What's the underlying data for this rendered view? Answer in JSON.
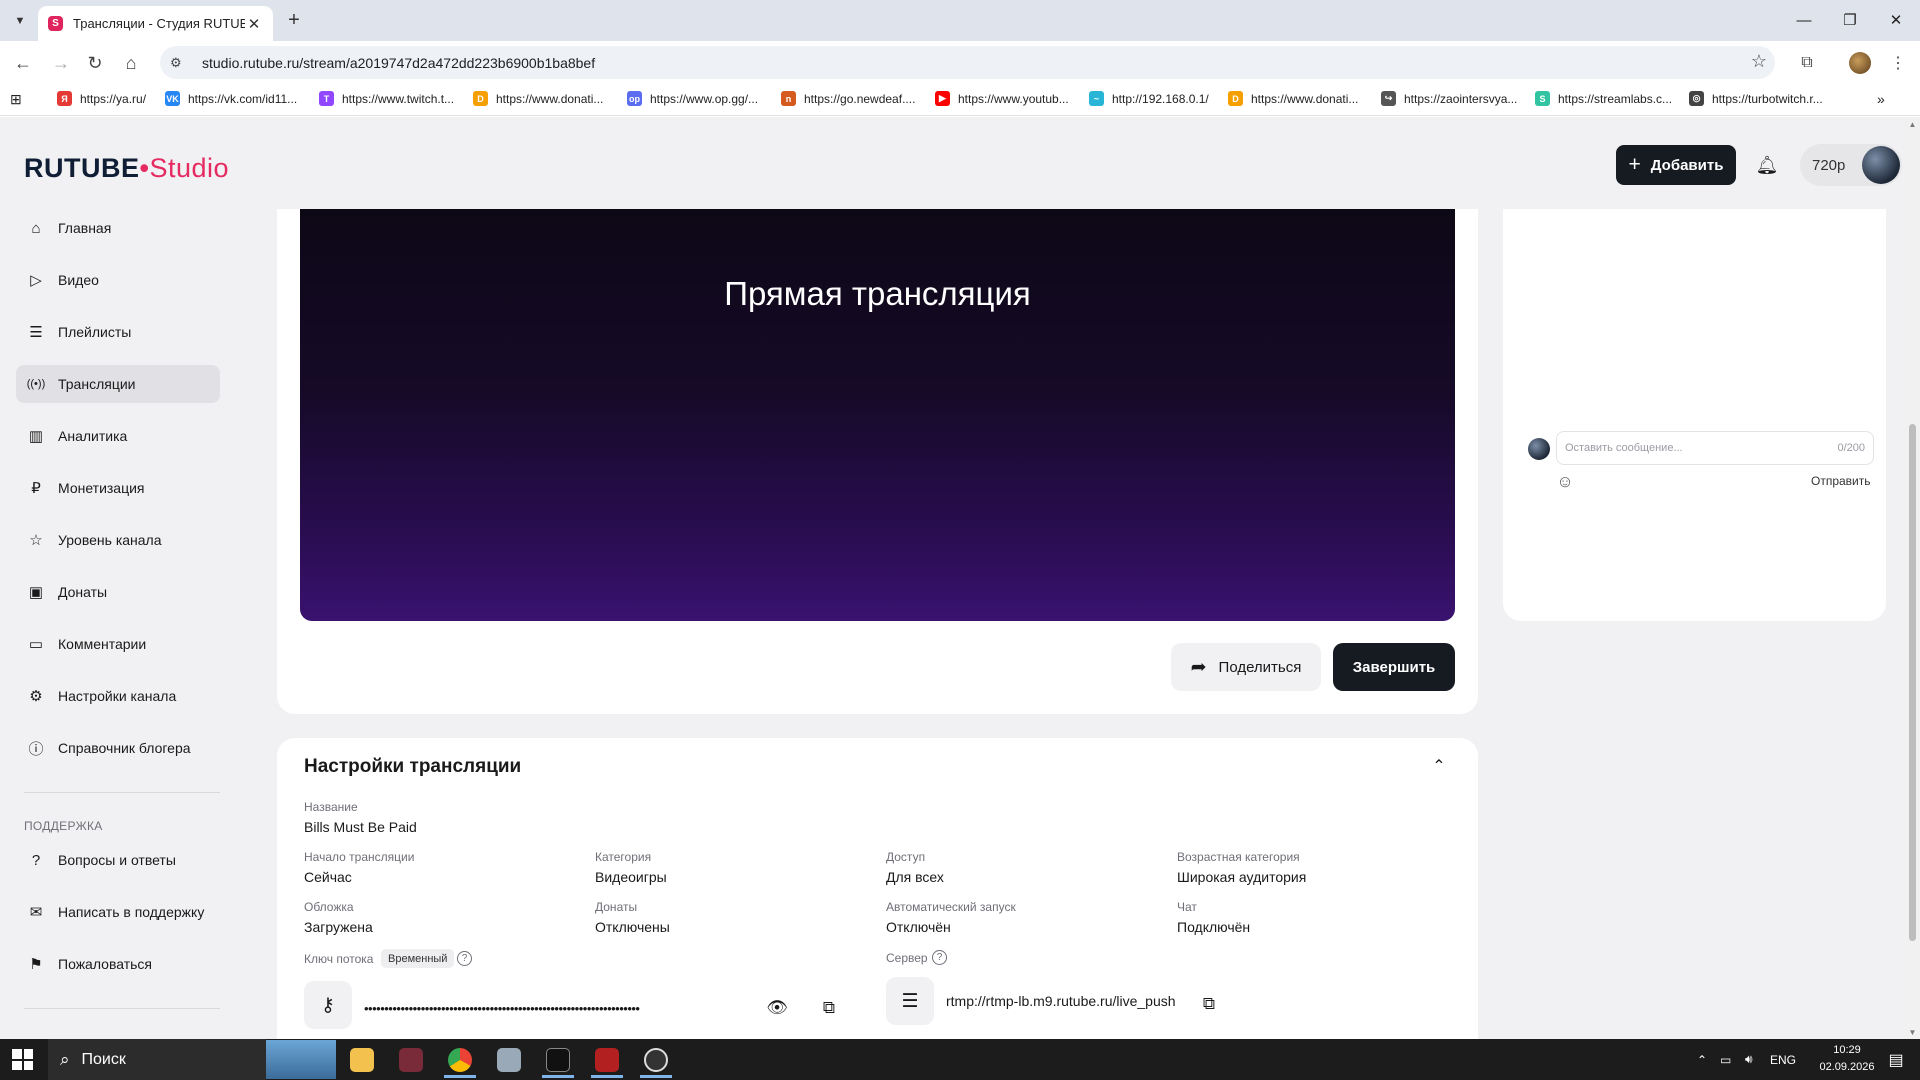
{
  "browser": {
    "tab_title": "Трансляции - Студия RUTUBE",
    "url": "studio.rutube.ru/stream/a2019747d2a472dd223b6900b1ba8bef",
    "bookmarks": [
      {
        "label": "https://ya.ru/",
        "color": "#e53935",
        "glyph": "Я"
      },
      {
        "label": "https://vk.com/id11...",
        "color": "#2787f5",
        "glyph": "VK"
      },
      {
        "label": "https://www.twitch.t...",
        "color": "#9146ff",
        "glyph": "T"
      },
      {
        "label": "https://www.donati...",
        "color": "#f59f00",
        "glyph": "D"
      },
      {
        "label": "https://www.op.gg/...",
        "color": "#5a6cf0",
        "glyph": "op"
      },
      {
        "label": "https://go.newdeaf....",
        "color": "#d45a1d",
        "glyph": "n"
      },
      {
        "label": "https://www.youtub...",
        "color": "#ff0000",
        "glyph": "▶"
      },
      {
        "label": "http://192.168.0.1/",
        "color": "#29b6d6",
        "glyph": "~"
      },
      {
        "label": "https://www.donati...",
        "color": "#f59f00",
        "glyph": "D"
      },
      {
        "label": "https://zaointersvya...",
        "color": "#555555",
        "glyph": "↪"
      },
      {
        "label": "https://streamlabs.c...",
        "color": "#31c3a2",
        "glyph": "S"
      },
      {
        "label": "https://turbotwitch.r...",
        "color": "#444444",
        "glyph": "◎"
      }
    ]
  },
  "header": {
    "logo_main": "RUTUBE",
    "logo_dot": "•",
    "logo_studio": "Studio",
    "add_button": "Добавить",
    "quality": "720p"
  },
  "sidebar": {
    "items": [
      {
        "label": "Главная",
        "icon": "⌂"
      },
      {
        "label": "Видео",
        "icon": "▷"
      },
      {
        "label": "Плейлисты",
        "icon": "☰"
      },
      {
        "label": "Трансляции",
        "icon": "((•))"
      },
      {
        "label": "Аналитика",
        "icon": "▥"
      },
      {
        "label": "Монетизация",
        "icon": "₽"
      },
      {
        "label": "Уровень канала",
        "icon": "☆"
      },
      {
        "label": "Донаты",
        "icon": "▣"
      },
      {
        "label": "Комментарии",
        "icon": "▭"
      },
      {
        "label": "Настройки канала",
        "icon": "⚙"
      },
      {
        "label": "Справочник блогера",
        "icon": "ⓘ"
      }
    ],
    "support_title": "ПОДДЕРЖКА",
    "support_items": [
      {
        "label": "Вопросы и ответы",
        "icon": "?"
      },
      {
        "label": "Написать в поддержку",
        "icon": "✉"
      },
      {
        "label": "Пожаловаться",
        "icon": "⚑"
      }
    ]
  },
  "player": {
    "title": "Прямая трансляция",
    "share_button": "Поделиться",
    "finish_button": "Завершить"
  },
  "chat": {
    "placeholder": "Оставить сообщение...",
    "counter": "0/200",
    "send": "Отправить"
  },
  "settings": {
    "title": "Настройки трансляции",
    "name_label": "Название",
    "name_value": "Bills Must Be Paid",
    "fields": [
      {
        "label": "Начало трансляции",
        "value": "Сейчас"
      },
      {
        "label": "Категория",
        "value": "Видеоигры"
      },
      {
        "label": "Доступ",
        "value": "Для всех"
      },
      {
        "label": "Возрастная категория",
        "value": "Широкая аудитория"
      },
      {
        "label": "Обложка",
        "value": "Загружена"
      },
      {
        "label": "Донаты",
        "value": "Отключены"
      },
      {
        "label": "Автоматический запуск",
        "value": "Отключён"
      },
      {
        "label": "Чат",
        "value": "Подключён"
      }
    ],
    "stream_key_label": "Ключ потока",
    "stream_key_badge": "Временный",
    "stream_key_value": "••••••••••••••••••••••••••••••••••••••••••••••••••••••••••••••••••••",
    "server_label": "Сервер",
    "server_value": "rtmp://rtmp-lb.m9.rutube.ru/live_push"
  },
  "taskbar": {
    "search": "Поиск",
    "lang": "ENG",
    "time": "10:29",
    "date": "02.09.2026"
  }
}
